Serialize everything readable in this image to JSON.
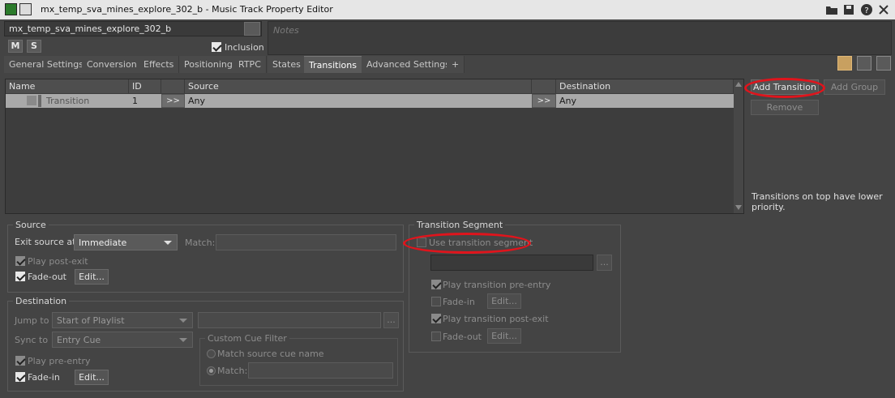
{
  "window": {
    "object_name": "mx_temp_sva_mines_explore_302_b",
    "title_suffix": " - Music Track Property Editor",
    "icons": [
      "folder-icon",
      "save-icon",
      "help-icon",
      "close-icon"
    ]
  },
  "header": {
    "name_value": "mx_temp_sva_mines_explore_302_b",
    "mute_label": "M",
    "solo_label": "S",
    "inclusion_label": "Inclusion",
    "inclusion_checked": true,
    "notes_placeholder": "Notes"
  },
  "tabs": [
    {
      "label": "General Settings",
      "active": false
    },
    {
      "label": "Conversion",
      "active": false
    },
    {
      "label": "Effects",
      "active": false
    },
    {
      "label": "Positioning",
      "active": false
    },
    {
      "label": "RTPC",
      "active": false
    },
    {
      "label": "States",
      "active": false
    },
    {
      "label": "Transitions",
      "active": true
    },
    {
      "label": "Advanced Settings",
      "active": false
    },
    {
      "label": "+",
      "active": false
    }
  ],
  "transitions_table": {
    "columns": [
      "Name",
      "ID",
      "",
      "Source",
      "",
      "Destination"
    ],
    "rows": [
      {
        "name": "Transition",
        "id": "1",
        "src_btn": ">>",
        "source": "Any",
        "dst_btn": ">>",
        "destination": "Any"
      }
    ]
  },
  "side_buttons": {
    "add_transition": "Add Transition",
    "add_group": "Add Group",
    "remove": "Remove",
    "hint": "Transitions on top have lower priority."
  },
  "source_group": {
    "title": "Source",
    "exit_label": "Exit source at",
    "exit_value": "Immediate",
    "match_label": "Match:",
    "play_post_exit": "Play post-exit",
    "fade_out": "Fade-out",
    "edit": "Edit..."
  },
  "destination_group": {
    "title": "Destination",
    "jump_label": "Jump to",
    "jump_value": "Start of Playlist",
    "sync_label": "Sync to",
    "sync_value": "Entry Cue",
    "browse": "...",
    "cue_filter_title": "Custom Cue Filter",
    "match_source_cue": "Match source cue name",
    "match_label": "Match:",
    "play_pre_entry": "Play pre-entry",
    "fade_in": "Fade-in",
    "edit": "Edit..."
  },
  "segment_group": {
    "title": "Transition Segment",
    "use_segment": "Use transition segment",
    "browse": "...",
    "play_pre_entry": "Play transition pre-entry",
    "fade_in": "Fade-in",
    "play_post_exit": "Play transition post-exit",
    "fade_out": "Fade-out",
    "edit": "Edit..."
  },
  "colors": {
    "annotation": "#e0141c",
    "panel": "#444444",
    "selected_row": "#a9a9a9"
  }
}
